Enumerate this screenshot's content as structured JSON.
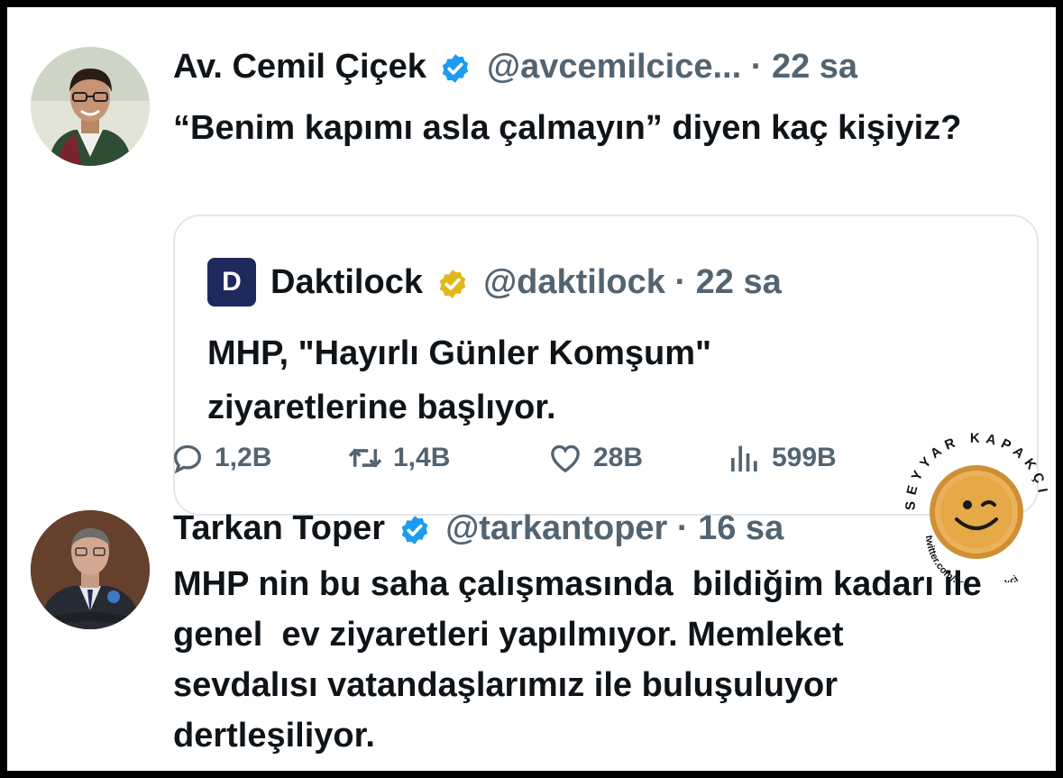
{
  "tweet1": {
    "name": "Av. Cemil Çiçek",
    "handle": "@avcemilcice...",
    "separator": "·",
    "time": "22 sa",
    "text": "“Benim kapımı asla çalmayın” diyen kaç kişiyiz?"
  },
  "quoted": {
    "logo_letter": "D",
    "name": "Daktilock",
    "handle": "@daktilock",
    "separator": "·",
    "time": "22 sa",
    "text": "MHP, \"Hayırlı Günler Komşum\" ziyaretlerine başlıyor."
  },
  "actions": {
    "replies": "1,2B",
    "retweets": "1,4B",
    "likes": "28B",
    "views": "599B",
    "icons": [
      "reply-icon",
      "retweet-icon",
      "like-icon",
      "views-icon"
    ]
  },
  "tweet2": {
    "name": "Tarkan Toper",
    "handle": "@tarkantoper",
    "separator": "·",
    "time": "16 sa",
    "text": "MHP nin bu saha çalışmasında  bildiğim kadarı ile genel  ev ziyaretleri yapılmıyor. Memleket sevdalısı vatandaşlarımız ile buluşuluyor dertleşiliyor."
  },
  "watermark": {
    "top_text": "SEYYAR KAPAKÇI",
    "bottom_text": "twitter.com/SeyyarKapakci"
  },
  "colors": {
    "verified_blue": "#1d9bf0",
    "verified_gold": "#e2b719",
    "muted_text": "#536471",
    "primary_text": "#0f1419",
    "logo_bg": "#1d2a5b",
    "cap_color": "#e6a948"
  }
}
